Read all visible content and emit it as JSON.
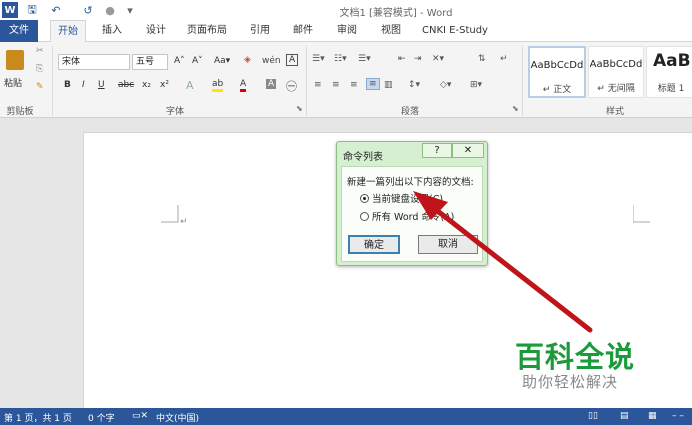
{
  "window": {
    "title": "文档1 [兼容模式] - Word"
  },
  "quick_access": {
    "save_glyph": "🖫",
    "undo_glyph": "↶",
    "redo_glyph": "↺",
    "more_glyph": "▾"
  },
  "tabs": [
    {
      "label": "文件"
    },
    {
      "label": "开始"
    },
    {
      "label": "插入"
    },
    {
      "label": "设计"
    },
    {
      "label": "页面布局"
    },
    {
      "label": "引用"
    },
    {
      "label": "邮件"
    },
    {
      "label": "审阅"
    },
    {
      "label": "视图"
    },
    {
      "label": "CNKI E-Study"
    }
  ],
  "ribbon": {
    "clipboard": {
      "paste_label": "粘贴",
      "group_label": "剪贴板"
    },
    "font": {
      "family": "宋体",
      "size": "五号",
      "grow": "A˄",
      "shrink": "A˅",
      "case": "Aa▾",
      "clear": "◈",
      "phonetic": "wén",
      "border": "A",
      "bold": "B",
      "italic": "I",
      "underline": "U",
      "strike": "abc",
      "sub": "x₂",
      "sup": "x²",
      "effects": "A",
      "highlight": "ab",
      "color": "A",
      "shade": "A",
      "enclose": "㊀",
      "group_label": "字体"
    },
    "paragraph": {
      "group_label": "段落"
    },
    "styles": {
      "group_label": "样式",
      "items": [
        {
          "sample": "AaBbCcDd",
          "name": "↵ 正文"
        },
        {
          "sample": "AaBbCcDd",
          "name": "↵ 无间隔"
        },
        {
          "sample": "AaB",
          "name": "标题 1"
        }
      ]
    }
  },
  "dialog": {
    "title": "命令列表",
    "help": "?",
    "close": "✕",
    "prompt": "新建一篇列出以下内容的文档:",
    "option1": "当前键盘设置(C)",
    "option2": "所有 Word 命令(A)",
    "ok": "确定",
    "cancel": "取消"
  },
  "status": {
    "page": "第 1 页，共 1 页",
    "words": "0 个字",
    "lang": "中文(中国)"
  },
  "watermark": {
    "title": "百科全说",
    "subtitle": "助你轻松解决"
  },
  "colors": {
    "accent": "#2b579a",
    "arrow": "#c0141b",
    "dialog_bg": "#d6efd0",
    "watermark_green": "#1a9a3a"
  }
}
